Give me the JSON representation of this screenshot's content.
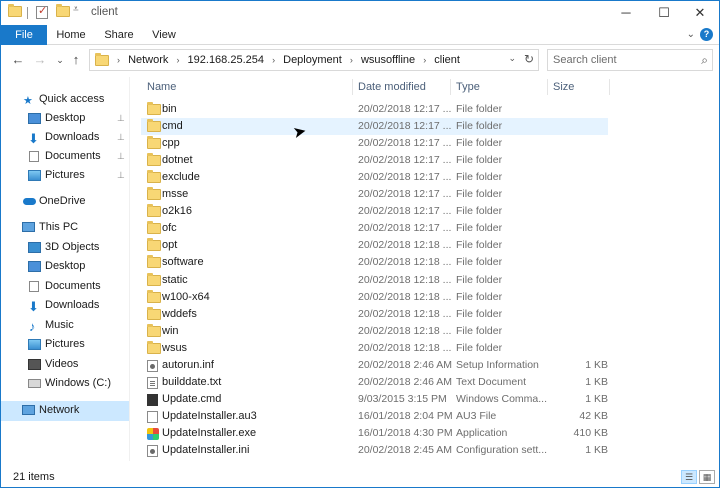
{
  "window": {
    "title": "client",
    "minimize": "─",
    "maximize": "☐",
    "close": "✕"
  },
  "ribbon": {
    "tabs": [
      "File",
      "Home",
      "Share",
      "View"
    ],
    "expand": "⌄",
    "help": "?"
  },
  "nav": {
    "back": "←",
    "forward": "→",
    "recent": "⌄",
    "up": "↑"
  },
  "address": {
    "crumbs": [
      "Network",
      "192.168.25.254",
      "Deployment",
      "wsusoffline",
      "client"
    ],
    "separator": "›",
    "dropdown": "⌄",
    "refresh": "↻"
  },
  "search": {
    "placeholder": "Search client",
    "icon": "⌕"
  },
  "sidebar": {
    "items": [
      {
        "label": "Quick access",
        "icon": "star-icon"
      },
      {
        "label": "Desktop",
        "icon": "desktop-icon",
        "pinned": true
      },
      {
        "label": "Downloads",
        "icon": "download-icon",
        "pinned": true
      },
      {
        "label": "Documents",
        "icon": "documents-icon",
        "pinned": true
      },
      {
        "label": "Pictures",
        "icon": "pictures-icon",
        "pinned": true
      },
      {
        "label": "OneDrive",
        "icon": "cloud-icon"
      },
      {
        "label": "This PC",
        "icon": "computer-icon"
      },
      {
        "label": "3D Objects",
        "icon": "3d-objects-icon"
      },
      {
        "label": "Desktop",
        "icon": "desktop-icon"
      },
      {
        "label": "Documents",
        "icon": "documents-icon"
      },
      {
        "label": "Downloads",
        "icon": "download-icon"
      },
      {
        "label": "Music",
        "icon": "music-icon"
      },
      {
        "label": "Pictures",
        "icon": "pictures-icon"
      },
      {
        "label": "Videos",
        "icon": "videos-icon"
      },
      {
        "label": "Windows (C:)",
        "icon": "drive-icon"
      },
      {
        "label": "Network",
        "icon": "network-icon",
        "selected": true
      }
    ],
    "pin_glyph": "📌"
  },
  "columns": {
    "name": "Name",
    "date": "Date modified",
    "type": "Type",
    "size": "Size"
  },
  "files": [
    {
      "name": "bin",
      "date": "20/02/2018 12:17 ...",
      "type": "File folder",
      "size": "",
      "icon": "folder-icon"
    },
    {
      "name": "cmd",
      "date": "20/02/2018 12:17 ...",
      "type": "File folder",
      "size": "",
      "icon": "folder-icon"
    },
    {
      "name": "cpp",
      "date": "20/02/2018 12:17 ...",
      "type": "File folder",
      "size": "",
      "icon": "folder-icon"
    },
    {
      "name": "dotnet",
      "date": "20/02/2018 12:17 ...",
      "type": "File folder",
      "size": "",
      "icon": "folder-icon"
    },
    {
      "name": "exclude",
      "date": "20/02/2018 12:17 ...",
      "type": "File folder",
      "size": "",
      "icon": "folder-icon"
    },
    {
      "name": "msse",
      "date": "20/02/2018 12:17 ...",
      "type": "File folder",
      "size": "",
      "icon": "folder-icon"
    },
    {
      "name": "o2k16",
      "date": "20/02/2018 12:17 ...",
      "type": "File folder",
      "size": "",
      "icon": "folder-icon"
    },
    {
      "name": "ofc",
      "date": "20/02/2018 12:17 ...",
      "type": "File folder",
      "size": "",
      "icon": "folder-icon"
    },
    {
      "name": "opt",
      "date": "20/02/2018 12:18 ...",
      "type": "File folder",
      "size": "",
      "icon": "folder-icon"
    },
    {
      "name": "software",
      "date": "20/02/2018 12:18 ...",
      "type": "File folder",
      "size": "",
      "icon": "folder-icon"
    },
    {
      "name": "static",
      "date": "20/02/2018 12:18 ...",
      "type": "File folder",
      "size": "",
      "icon": "folder-icon"
    },
    {
      "name": "w100-x64",
      "date": "20/02/2018 12:18 ...",
      "type": "File folder",
      "size": "",
      "icon": "folder-icon"
    },
    {
      "name": "wddefs",
      "date": "20/02/2018 12:18 ...",
      "type": "File folder",
      "size": "",
      "icon": "folder-icon"
    },
    {
      "name": "win",
      "date": "20/02/2018 12:18 ...",
      "type": "File folder",
      "size": "",
      "icon": "folder-icon"
    },
    {
      "name": "wsus",
      "date": "20/02/2018 12:18 ...",
      "type": "File folder",
      "size": "",
      "icon": "folder-icon"
    },
    {
      "name": "autorun.inf",
      "date": "20/02/2018 2:46 AM",
      "type": "Setup Information",
      "size": "1 KB",
      "icon": "setup-file-icon"
    },
    {
      "name": "builddate.txt",
      "date": "20/02/2018 2:46 AM",
      "type": "Text Document",
      "size": "1 KB",
      "icon": "text-file-icon"
    },
    {
      "name": "Update.cmd",
      "date": "9/03/2015 3:15 PM",
      "type": "Windows Comma...",
      "size": "1 KB",
      "icon": "cmd-file-icon"
    },
    {
      "name": "UpdateInstaller.au3",
      "date": "16/01/2018 2:04 PM",
      "type": "AU3 File",
      "size": "42 KB",
      "icon": "file-icon"
    },
    {
      "name": "UpdateInstaller.exe",
      "date": "16/01/2018 4:30 PM",
      "type": "Application",
      "size": "410 KB",
      "icon": "exe-icon"
    },
    {
      "name": "UpdateInstaller.ini",
      "date": "20/02/2018 2:45 AM",
      "type": "Configuration sett...",
      "size": "1 KB",
      "icon": "config-file-icon"
    }
  ],
  "status": {
    "count": "21 items",
    "details_view": "☰",
    "tiles_view": "▦"
  },
  "colors": {
    "accent": "#1979ca",
    "selection": "#cce8ff",
    "hover": "#e5f3ff",
    "folder": "#f8d775"
  }
}
